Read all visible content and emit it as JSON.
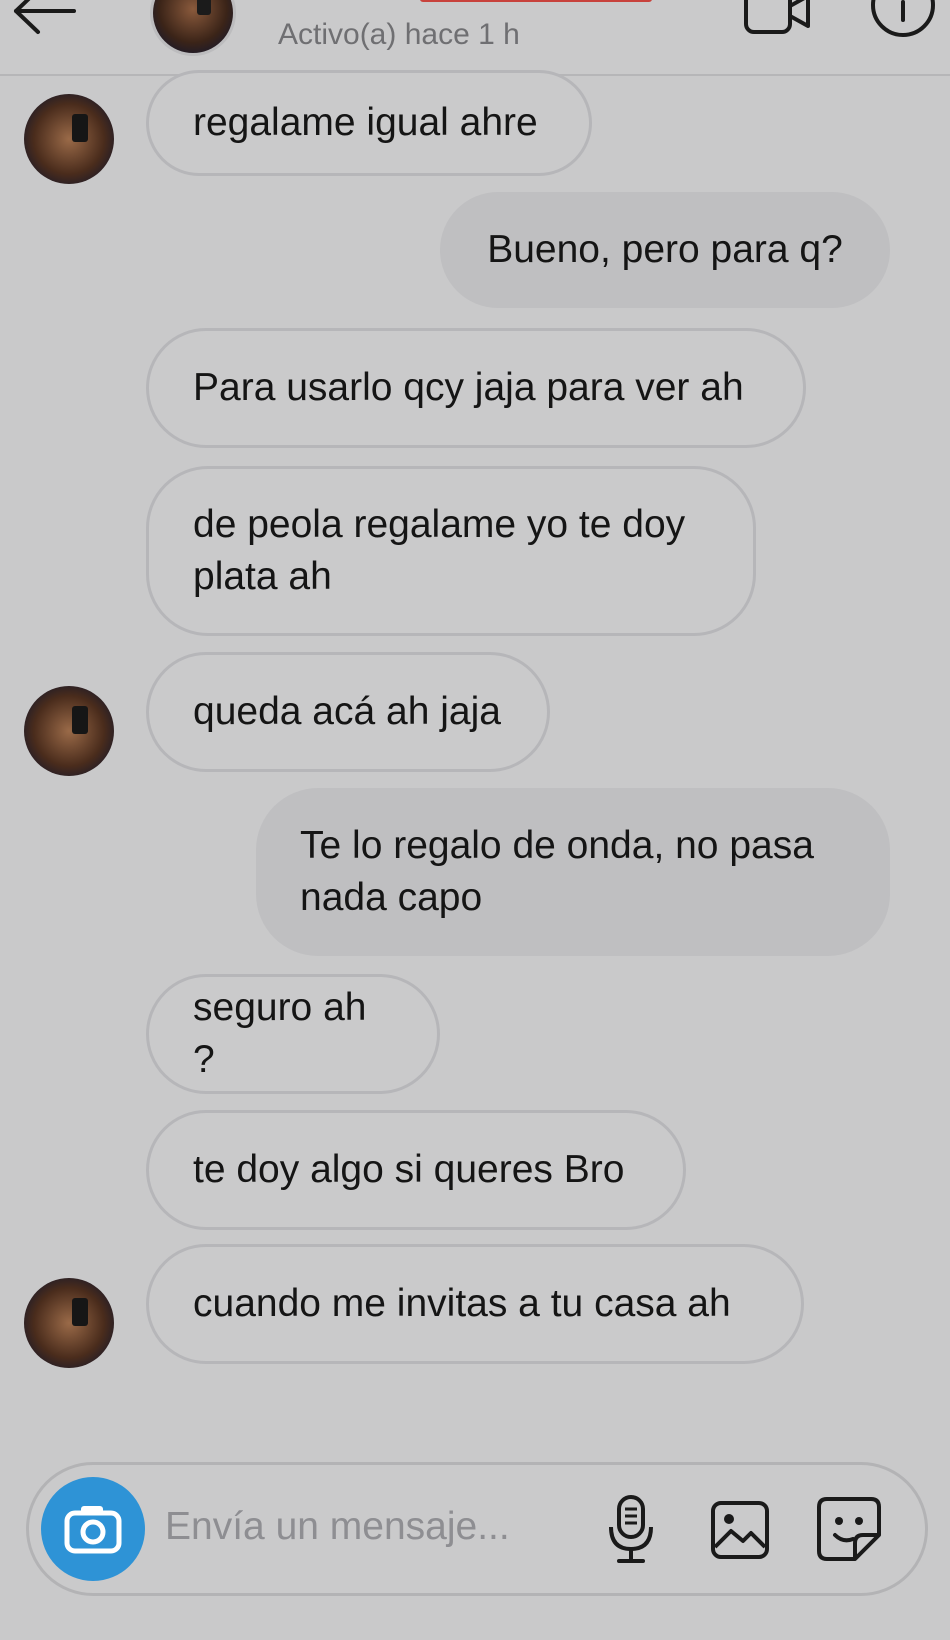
{
  "header": {
    "status": "Activo(a) hace 1 h",
    "back_icon": "arrow-left-icon",
    "video_icon": "video-call-icon",
    "info_icon": "info-icon"
  },
  "messages": [
    {
      "direction": "incoming",
      "text": "regalame igual ahre",
      "show_avatar": true
    },
    {
      "direction": "outgoing",
      "text": "Bueno, pero para q?"
    },
    {
      "direction": "incoming",
      "text": "Para usarlo qcy jaja para ver ah",
      "show_avatar": false
    },
    {
      "direction": "incoming",
      "text": "de peola regalame yo te doy plata ah",
      "show_avatar": false
    },
    {
      "direction": "incoming",
      "text": "queda acá ah jaja",
      "show_avatar": true
    },
    {
      "direction": "outgoing",
      "text": "Te lo regalo de onda, no pasa nada capo"
    },
    {
      "direction": "incoming",
      "text": "seguro ah ?",
      "show_avatar": false
    },
    {
      "direction": "incoming",
      "text": "te doy algo si queres Bro",
      "show_avatar": false
    },
    {
      "direction": "incoming",
      "text": "cuando me invitas a tu casa ah",
      "show_avatar": true
    }
  ],
  "composer": {
    "placeholder": "Envía un mensaje...",
    "camera_icon": "camera-icon",
    "mic_icon": "microphone-icon",
    "gallery_icon": "gallery-icon",
    "sticker_icon": "sticker-icon"
  },
  "colors": {
    "background": "#c9c9ca",
    "incoming_border": "#b6b6b9",
    "outgoing_fill": "#bfbfc1",
    "camera_blue": "#2e93d6",
    "name_redaction": "#c8423c"
  }
}
